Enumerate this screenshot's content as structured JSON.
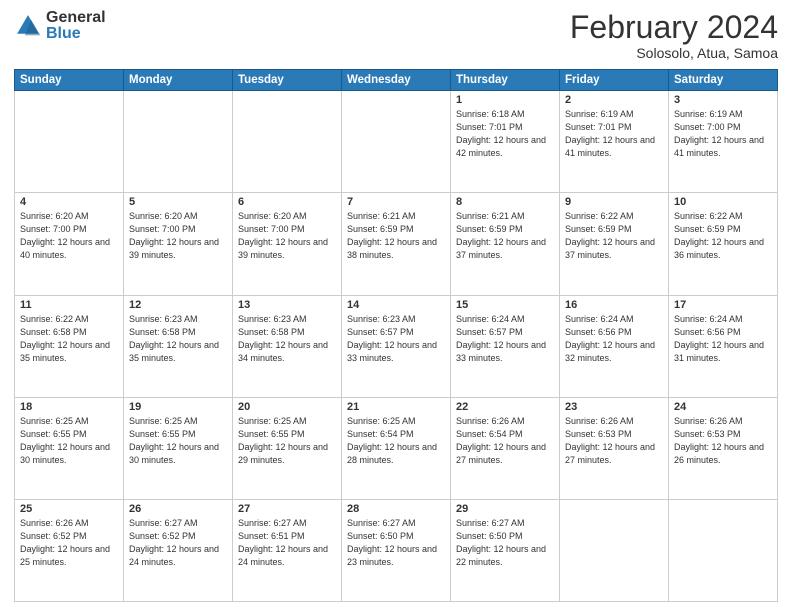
{
  "header": {
    "logo_general": "General",
    "logo_blue": "Blue",
    "title": "February 2024",
    "subtitle": "Solosolo, Atua, Samoa"
  },
  "weekdays": [
    "Sunday",
    "Monday",
    "Tuesday",
    "Wednesday",
    "Thursday",
    "Friday",
    "Saturday"
  ],
  "weeks": [
    [
      {
        "day": "",
        "info": ""
      },
      {
        "day": "",
        "info": ""
      },
      {
        "day": "",
        "info": ""
      },
      {
        "day": "",
        "info": ""
      },
      {
        "day": "1",
        "info": "Sunrise: 6:18 AM\nSunset: 7:01 PM\nDaylight: 12 hours\nand 42 minutes."
      },
      {
        "day": "2",
        "info": "Sunrise: 6:19 AM\nSunset: 7:01 PM\nDaylight: 12 hours\nand 41 minutes."
      },
      {
        "day": "3",
        "info": "Sunrise: 6:19 AM\nSunset: 7:00 PM\nDaylight: 12 hours\nand 41 minutes."
      }
    ],
    [
      {
        "day": "4",
        "info": "Sunrise: 6:20 AM\nSunset: 7:00 PM\nDaylight: 12 hours\nand 40 minutes."
      },
      {
        "day": "5",
        "info": "Sunrise: 6:20 AM\nSunset: 7:00 PM\nDaylight: 12 hours\nand 39 minutes."
      },
      {
        "day": "6",
        "info": "Sunrise: 6:20 AM\nSunset: 7:00 PM\nDaylight: 12 hours\nand 39 minutes."
      },
      {
        "day": "7",
        "info": "Sunrise: 6:21 AM\nSunset: 6:59 PM\nDaylight: 12 hours\nand 38 minutes."
      },
      {
        "day": "8",
        "info": "Sunrise: 6:21 AM\nSunset: 6:59 PM\nDaylight: 12 hours\nand 37 minutes."
      },
      {
        "day": "9",
        "info": "Sunrise: 6:22 AM\nSunset: 6:59 PM\nDaylight: 12 hours\nand 37 minutes."
      },
      {
        "day": "10",
        "info": "Sunrise: 6:22 AM\nSunset: 6:59 PM\nDaylight: 12 hours\nand 36 minutes."
      }
    ],
    [
      {
        "day": "11",
        "info": "Sunrise: 6:22 AM\nSunset: 6:58 PM\nDaylight: 12 hours\nand 35 minutes."
      },
      {
        "day": "12",
        "info": "Sunrise: 6:23 AM\nSunset: 6:58 PM\nDaylight: 12 hours\nand 35 minutes."
      },
      {
        "day": "13",
        "info": "Sunrise: 6:23 AM\nSunset: 6:58 PM\nDaylight: 12 hours\nand 34 minutes."
      },
      {
        "day": "14",
        "info": "Sunrise: 6:23 AM\nSunset: 6:57 PM\nDaylight: 12 hours\nand 33 minutes."
      },
      {
        "day": "15",
        "info": "Sunrise: 6:24 AM\nSunset: 6:57 PM\nDaylight: 12 hours\nand 33 minutes."
      },
      {
        "day": "16",
        "info": "Sunrise: 6:24 AM\nSunset: 6:56 PM\nDaylight: 12 hours\nand 32 minutes."
      },
      {
        "day": "17",
        "info": "Sunrise: 6:24 AM\nSunset: 6:56 PM\nDaylight: 12 hours\nand 31 minutes."
      }
    ],
    [
      {
        "day": "18",
        "info": "Sunrise: 6:25 AM\nSunset: 6:55 PM\nDaylight: 12 hours\nand 30 minutes."
      },
      {
        "day": "19",
        "info": "Sunrise: 6:25 AM\nSunset: 6:55 PM\nDaylight: 12 hours\nand 30 minutes."
      },
      {
        "day": "20",
        "info": "Sunrise: 6:25 AM\nSunset: 6:55 PM\nDaylight: 12 hours\nand 29 minutes."
      },
      {
        "day": "21",
        "info": "Sunrise: 6:25 AM\nSunset: 6:54 PM\nDaylight: 12 hours\nand 28 minutes."
      },
      {
        "day": "22",
        "info": "Sunrise: 6:26 AM\nSunset: 6:54 PM\nDaylight: 12 hours\nand 27 minutes."
      },
      {
        "day": "23",
        "info": "Sunrise: 6:26 AM\nSunset: 6:53 PM\nDaylight: 12 hours\nand 27 minutes."
      },
      {
        "day": "24",
        "info": "Sunrise: 6:26 AM\nSunset: 6:53 PM\nDaylight: 12 hours\nand 26 minutes."
      }
    ],
    [
      {
        "day": "25",
        "info": "Sunrise: 6:26 AM\nSunset: 6:52 PM\nDaylight: 12 hours\nand 25 minutes."
      },
      {
        "day": "26",
        "info": "Sunrise: 6:27 AM\nSunset: 6:52 PM\nDaylight: 12 hours\nand 24 minutes."
      },
      {
        "day": "27",
        "info": "Sunrise: 6:27 AM\nSunset: 6:51 PM\nDaylight: 12 hours\nand 24 minutes."
      },
      {
        "day": "28",
        "info": "Sunrise: 6:27 AM\nSunset: 6:50 PM\nDaylight: 12 hours\nand 23 minutes."
      },
      {
        "day": "29",
        "info": "Sunrise: 6:27 AM\nSunset: 6:50 PM\nDaylight: 12 hours\nand 22 minutes."
      },
      {
        "day": "",
        "info": ""
      },
      {
        "day": "",
        "info": ""
      }
    ]
  ]
}
